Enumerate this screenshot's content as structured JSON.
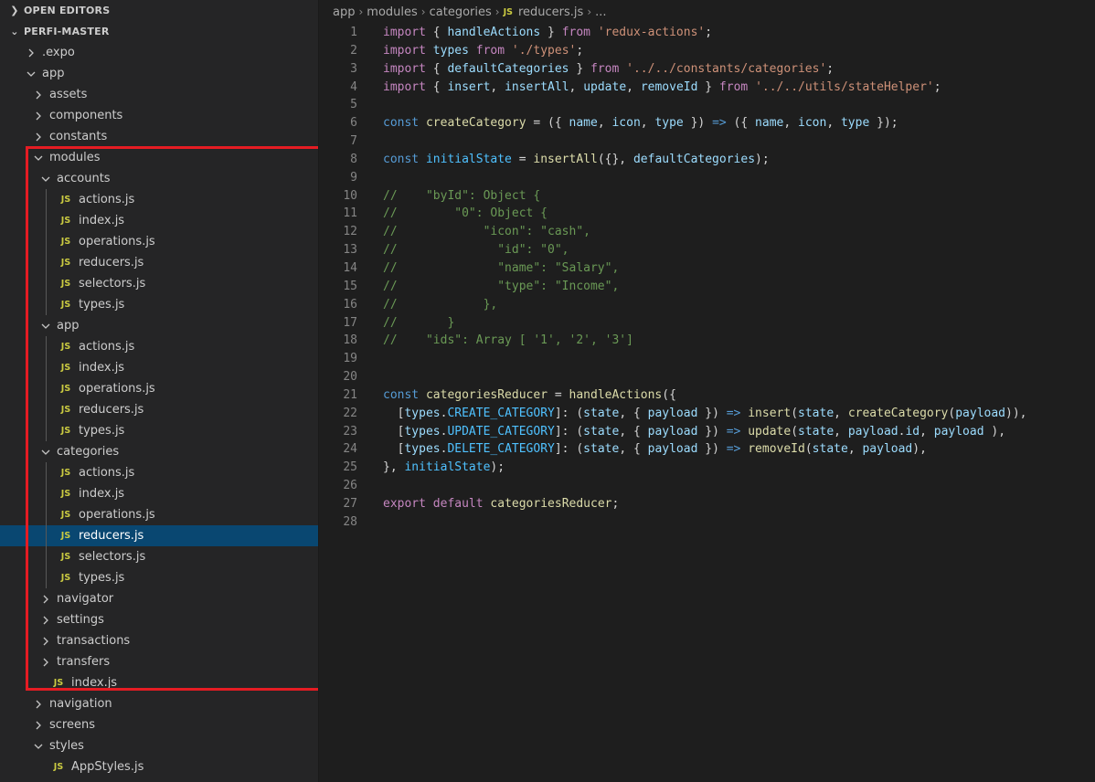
{
  "explorer": {
    "open_editors": "OPEN EDITORS",
    "project": "PERFI-MASTER",
    "tree": [
      {
        "label": ".expo",
        "type": "folder",
        "depth": 1,
        "open": false
      },
      {
        "label": "app",
        "type": "folder",
        "depth": 1,
        "open": true
      },
      {
        "label": "assets",
        "type": "folder",
        "depth": 2,
        "open": false
      },
      {
        "label": "components",
        "type": "folder",
        "depth": 2,
        "open": false
      },
      {
        "label": "constants",
        "type": "folder",
        "depth": 2,
        "open": false
      },
      {
        "label": "modules",
        "type": "folder",
        "depth": 2,
        "open": true
      },
      {
        "label": "accounts",
        "type": "folder",
        "depth": 3,
        "open": true
      },
      {
        "label": "actions.js",
        "type": "js",
        "depth": 4
      },
      {
        "label": "index.js",
        "type": "js",
        "depth": 4
      },
      {
        "label": "operations.js",
        "type": "js",
        "depth": 4
      },
      {
        "label": "reducers.js",
        "type": "js",
        "depth": 4
      },
      {
        "label": "selectors.js",
        "type": "js",
        "depth": 4
      },
      {
        "label": "types.js",
        "type": "js",
        "depth": 4
      },
      {
        "label": "app",
        "type": "folder",
        "depth": 3,
        "open": true
      },
      {
        "label": "actions.js",
        "type": "js",
        "depth": 4
      },
      {
        "label": "index.js",
        "type": "js",
        "depth": 4
      },
      {
        "label": "operations.js",
        "type": "js",
        "depth": 4
      },
      {
        "label": "reducers.js",
        "type": "js",
        "depth": 4
      },
      {
        "label": "types.js",
        "type": "js",
        "depth": 4
      },
      {
        "label": "categories",
        "type": "folder",
        "depth": 3,
        "open": true
      },
      {
        "label": "actions.js",
        "type": "js",
        "depth": 4
      },
      {
        "label": "index.js",
        "type": "js",
        "depth": 4
      },
      {
        "label": "operations.js",
        "type": "js",
        "depth": 4
      },
      {
        "label": "reducers.js",
        "type": "js",
        "depth": 4,
        "selected": true
      },
      {
        "label": "selectors.js",
        "type": "js",
        "depth": 4
      },
      {
        "label": "types.js",
        "type": "js",
        "depth": 4
      },
      {
        "label": "navigator",
        "type": "folder",
        "depth": 3,
        "open": false
      },
      {
        "label": "settings",
        "type": "folder",
        "depth": 3,
        "open": false
      },
      {
        "label": "transactions",
        "type": "folder",
        "depth": 3,
        "open": false
      },
      {
        "label": "transfers",
        "type": "folder",
        "depth": 3,
        "open": false
      },
      {
        "label": "index.js",
        "type": "js",
        "depth": 3
      },
      {
        "label": "navigation",
        "type": "folder",
        "depth": 2,
        "open": false
      },
      {
        "label": "screens",
        "type": "folder",
        "depth": 2,
        "open": false
      },
      {
        "label": "styles",
        "type": "folder",
        "depth": 2,
        "open": true
      },
      {
        "label": "AppStyles.js",
        "type": "js",
        "depth": 3
      }
    ]
  },
  "breadcrumb": [
    "app",
    "modules",
    "categories",
    "reducers.js",
    "..."
  ],
  "js_icon_text": "JS",
  "code_lines": [
    [
      [
        "kw",
        "import"
      ],
      [
        "txt",
        " { "
      ],
      [
        "var",
        "handleActions"
      ],
      [
        "txt",
        " } "
      ],
      [
        "kw",
        "from"
      ],
      [
        "txt",
        " "
      ],
      [
        "str",
        "'redux-actions'"
      ],
      [
        "txt",
        ";"
      ]
    ],
    [
      [
        "kw",
        "import"
      ],
      [
        "txt",
        " "
      ],
      [
        "var",
        "types"
      ],
      [
        "txt",
        " "
      ],
      [
        "kw",
        "from"
      ],
      [
        "txt",
        " "
      ],
      [
        "str",
        "'./types'"
      ],
      [
        "txt",
        ";"
      ]
    ],
    [
      [
        "kw",
        "import"
      ],
      [
        "txt",
        " { "
      ],
      [
        "var",
        "defaultCategories"
      ],
      [
        "txt",
        " } "
      ],
      [
        "kw",
        "from"
      ],
      [
        "txt",
        " "
      ],
      [
        "str",
        "'../../constants/categories'"
      ],
      [
        "txt",
        ";"
      ]
    ],
    [
      [
        "kw",
        "import"
      ],
      [
        "txt",
        " { "
      ],
      [
        "var",
        "insert"
      ],
      [
        "txt",
        ", "
      ],
      [
        "var",
        "insertAll"
      ],
      [
        "txt",
        ", "
      ],
      [
        "var",
        "update"
      ],
      [
        "txt",
        ", "
      ],
      [
        "var",
        "removeId"
      ],
      [
        "txt",
        " } "
      ],
      [
        "kw",
        "from"
      ],
      [
        "txt",
        " "
      ],
      [
        "str",
        "'../../utils/stateHelper'"
      ],
      [
        "txt",
        ";"
      ]
    ],
    [],
    [
      [
        "kb",
        "const"
      ],
      [
        "txt",
        " "
      ],
      [
        "fn",
        "createCategory"
      ],
      [
        "txt",
        " = ({ "
      ],
      [
        "var",
        "name"
      ],
      [
        "txt",
        ", "
      ],
      [
        "var",
        "icon"
      ],
      [
        "txt",
        ", "
      ],
      [
        "var",
        "type"
      ],
      [
        "txt",
        " }) "
      ],
      [
        "kb",
        "=>"
      ],
      [
        "txt",
        " ({ "
      ],
      [
        "var",
        "name"
      ],
      [
        "txt",
        ", "
      ],
      [
        "var",
        "icon"
      ],
      [
        "txt",
        ", "
      ],
      [
        "var",
        "type"
      ],
      [
        "txt",
        " });"
      ]
    ],
    [],
    [
      [
        "kb",
        "const"
      ],
      [
        "txt",
        " "
      ],
      [
        "cst",
        "initialState"
      ],
      [
        "txt",
        " = "
      ],
      [
        "fn",
        "insertAll"
      ],
      [
        "txt",
        "({}, "
      ],
      [
        "var",
        "defaultCategories"
      ],
      [
        "txt",
        ");"
      ]
    ],
    [],
    [
      [
        "cm",
        "//    \"byId\": Object {"
      ]
    ],
    [
      [
        "cm",
        "//        \"0\": Object {"
      ]
    ],
    [
      [
        "cm",
        "//            \"icon\": \"cash\","
      ]
    ],
    [
      [
        "cm",
        "//              \"id\": \"0\","
      ]
    ],
    [
      [
        "cm",
        "//              \"name\": \"Salary\","
      ]
    ],
    [
      [
        "cm",
        "//              \"type\": \"Income\","
      ]
    ],
    [
      [
        "cm",
        "//            },"
      ]
    ],
    [
      [
        "cm",
        "//       }"
      ]
    ],
    [
      [
        "cm",
        "//    \"ids\": Array [ '1', '2', '3']"
      ]
    ],
    [],
    [],
    [
      [
        "kb",
        "const"
      ],
      [
        "txt",
        " "
      ],
      [
        "fn",
        "categoriesReducer"
      ],
      [
        "txt",
        " = "
      ],
      [
        "fn",
        "handleActions"
      ],
      [
        "txt",
        "({"
      ]
    ],
    [
      [
        "txt",
        "  ["
      ],
      [
        "var",
        "types"
      ],
      [
        "txt",
        "."
      ],
      [
        "cst",
        "CREATE_CATEGORY"
      ],
      [
        "txt",
        "]: ("
      ],
      [
        "var",
        "state"
      ],
      [
        "txt",
        ", { "
      ],
      [
        "var",
        "payload"
      ],
      [
        "txt",
        " }) "
      ],
      [
        "kb",
        "=>"
      ],
      [
        "txt",
        " "
      ],
      [
        "fn",
        "insert"
      ],
      [
        "txt",
        "("
      ],
      [
        "var",
        "state"
      ],
      [
        "txt",
        ", "
      ],
      [
        "fn",
        "createCategory"
      ],
      [
        "txt",
        "("
      ],
      [
        "var",
        "payload"
      ],
      [
        "txt",
        ")),"
      ]
    ],
    [
      [
        "txt",
        "  ["
      ],
      [
        "var",
        "types"
      ],
      [
        "txt",
        "."
      ],
      [
        "cst",
        "UPDATE_CATEGORY"
      ],
      [
        "txt",
        "]: ("
      ],
      [
        "var",
        "state"
      ],
      [
        "txt",
        ", { "
      ],
      [
        "var",
        "payload"
      ],
      [
        "txt",
        " }) "
      ],
      [
        "kb",
        "=>"
      ],
      [
        "txt",
        " "
      ],
      [
        "fn",
        "update"
      ],
      [
        "txt",
        "("
      ],
      [
        "var",
        "state"
      ],
      [
        "txt",
        ", "
      ],
      [
        "var",
        "payload"
      ],
      [
        "txt",
        "."
      ],
      [
        "var",
        "id"
      ],
      [
        "txt",
        ", "
      ],
      [
        "var",
        "payload"
      ],
      [
        "txt",
        " ),"
      ]
    ],
    [
      [
        "txt",
        "  ["
      ],
      [
        "var",
        "types"
      ],
      [
        "txt",
        "."
      ],
      [
        "cst",
        "DELETE_CATEGORY"
      ],
      [
        "txt",
        "]: ("
      ],
      [
        "var",
        "state"
      ],
      [
        "txt",
        ", { "
      ],
      [
        "var",
        "payload"
      ],
      [
        "txt",
        " }) "
      ],
      [
        "kb",
        "=>"
      ],
      [
        "txt",
        " "
      ],
      [
        "fn",
        "removeId"
      ],
      [
        "txt",
        "("
      ],
      [
        "var",
        "state"
      ],
      [
        "txt",
        ", "
      ],
      [
        "var",
        "payload"
      ],
      [
        "txt",
        "),"
      ]
    ],
    [
      [
        "txt",
        "}, "
      ],
      [
        "cst",
        "initialState"
      ],
      [
        "txt",
        ");"
      ]
    ],
    [],
    [
      [
        "kw",
        "export"
      ],
      [
        "txt",
        " "
      ],
      [
        "kw",
        "default"
      ],
      [
        "txt",
        " "
      ],
      [
        "fn",
        "categoriesReducer"
      ],
      [
        "txt",
        ";"
      ]
    ],
    []
  ],
  "colors": {
    "selected_row": "#094771",
    "highlight_box": "#e51c23",
    "js_icon": "#cbcb41"
  }
}
